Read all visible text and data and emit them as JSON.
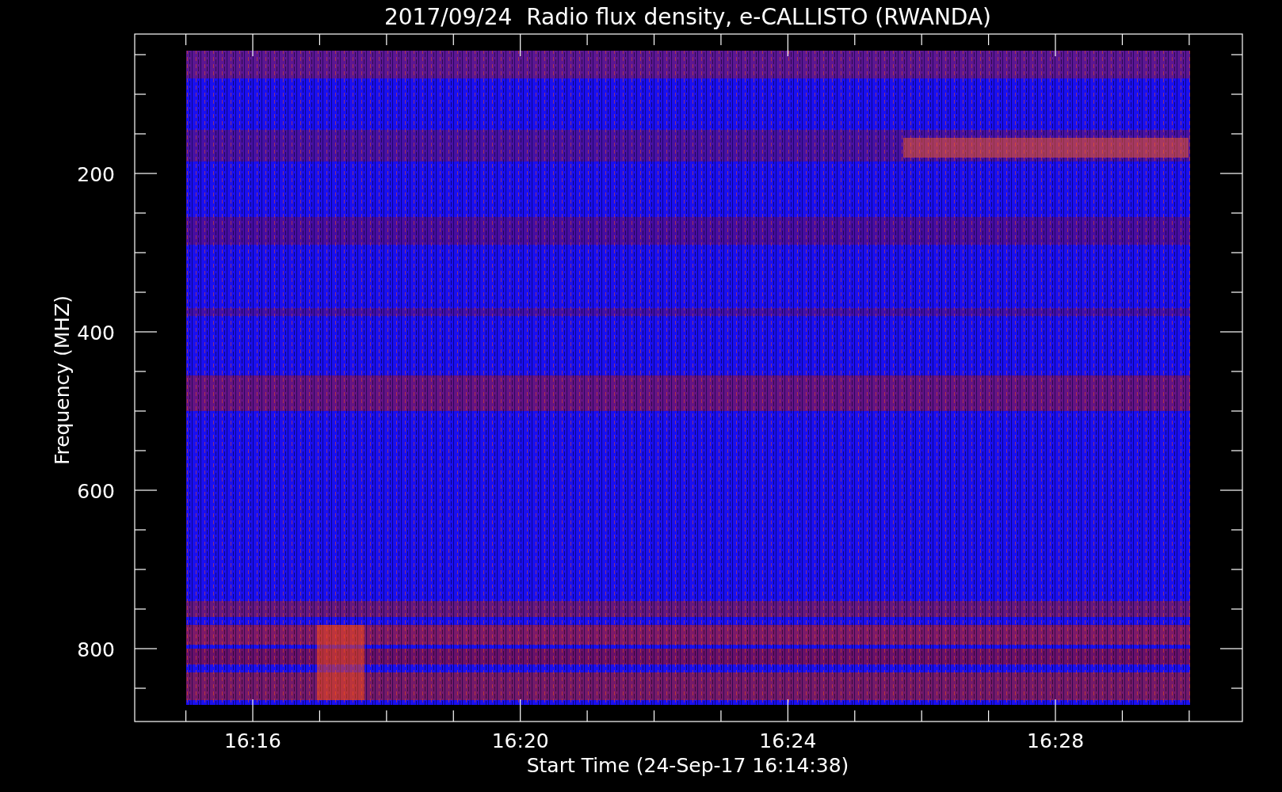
{
  "title": "2017/09/24  Radio flux density, e-CALLISTO (RWANDA)",
  "y_axis": {
    "label": "Frequency (MHZ)",
    "ticks": [
      "200",
      "400",
      "600",
      "800"
    ]
  },
  "x_axis": {
    "label": "Start Time (24-Sep-17 16:14:38)",
    "ticks": [
      "16:16",
      "16:20",
      "16:24",
      "16:28"
    ]
  }
}
